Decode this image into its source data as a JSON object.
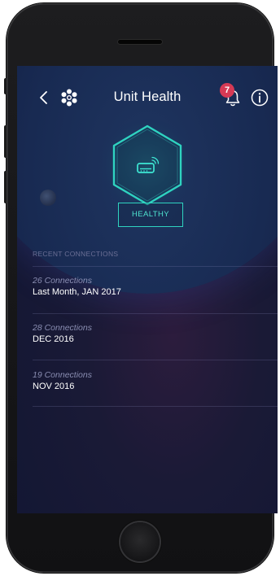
{
  "header": {
    "title": "Unit Health",
    "notification_count": "7",
    "back_icon": "chevron-left-icon",
    "logo_icon": "flower-logo-icon",
    "bell_icon": "bell-icon",
    "info_icon": "info-icon"
  },
  "device": {
    "icon": "router-wifi-icon",
    "status_label": "HEALTHY"
  },
  "recent_connections": {
    "header": "RECENT CONNECTIONS",
    "items": [
      {
        "count": "26 Connections",
        "period": "Last Month, JAN 2017"
      },
      {
        "count": "28 Connections",
        "period": "DEC 2016"
      },
      {
        "count": "19 Connections",
        "period": "NOV 2016"
      }
    ]
  },
  "colors": {
    "accent": "#2fd3c0",
    "badge": "#d63a55",
    "background": "#141a3a"
  }
}
